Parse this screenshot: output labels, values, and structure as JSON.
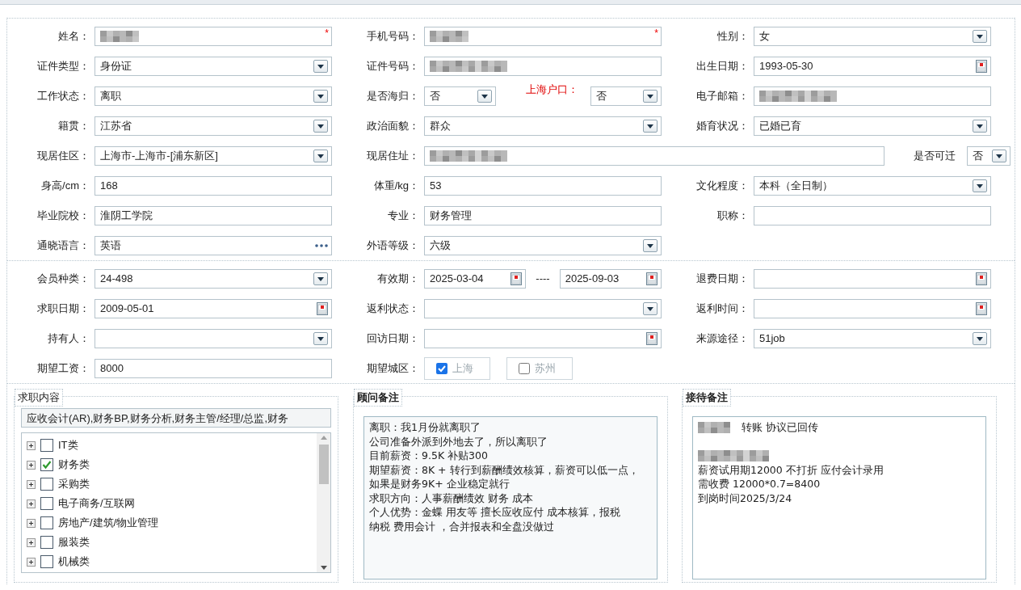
{
  "sections": [
    {
      "rows": [
        {
          "groups": [
            {
              "wide": false,
              "items": [
                {
                  "kind": "label",
                  "text": "姓名："
                },
                {
                  "kind": "text",
                  "redacted": true,
                  "required_mark": "*"
                }
              ]
            },
            {
              "wide": false,
              "items": [
                {
                  "kind": "label",
                  "text": "手机号码："
                },
                {
                  "kind": "text",
                  "redacted": true,
                  "required_mark": "*"
                }
              ]
            },
            {
              "wide": false,
              "items": [
                {
                  "kind": "label",
                  "text": "性别："
                },
                {
                  "kind": "select",
                  "value": "女"
                }
              ]
            }
          ]
        },
        {
          "groups": [
            {
              "wide": false,
              "items": [
                {
                  "kind": "label",
                  "text": "证件类型："
                },
                {
                  "kind": "select",
                  "value": "身份证"
                }
              ]
            },
            {
              "wide": false,
              "items": [
                {
                  "kind": "label",
                  "text": "证件号码："
                },
                {
                  "kind": "text",
                  "redacted": true
                }
              ]
            },
            {
              "wide": false,
              "items": [
                {
                  "kind": "label",
                  "text": "出生日期："
                },
                {
                  "kind": "date",
                  "value": "1993-05-30"
                }
              ]
            }
          ]
        },
        {
          "groups": [
            {
              "wide": false,
              "items": [
                {
                  "kind": "label",
                  "text": "工作状态："
                },
                {
                  "kind": "select",
                  "value": "离职"
                }
              ]
            },
            {
              "wide": false,
              "items": [
                {
                  "kind": "label",
                  "text": "是否海归：",
                  "alert": false
                },
                {
                  "kind": "select",
                  "value": "否"
                },
                {
                  "kind": "label",
                  "text": "上海户口：",
                  "alert": true
                },
                {
                  "kind": "select",
                  "value": "否"
                }
              ]
            },
            {
              "wide": false,
              "items": [
                {
                  "kind": "label",
                  "text": "电子邮箱："
                },
                {
                  "kind": "text",
                  "redacted": true
                }
              ]
            }
          ]
        },
        {
          "groups": [
            {
              "wide": false,
              "items": [
                {
                  "kind": "label",
                  "text": "籍贯："
                },
                {
                  "kind": "select",
                  "value": "江苏省"
                }
              ]
            },
            {
              "wide": false,
              "items": [
                {
                  "kind": "label",
                  "text": "政治面貌："
                },
                {
                  "kind": "select",
                  "value": "群众"
                }
              ]
            },
            {
              "wide": false,
              "items": [
                {
                  "kind": "label",
                  "text": "婚育状况："
                },
                {
                  "kind": "select",
                  "value": "已婚已育"
                }
              ]
            }
          ]
        },
        {
          "groups": [
            {
              "wide": false,
              "items": [
                {
                  "kind": "label",
                  "text": "现居住区："
                },
                {
                  "kind": "select",
                  "value": "上海市-上海市-[浦东新区]"
                }
              ]
            },
            {
              "wide": true,
              "items": [
                {
                  "kind": "label",
                  "text": "现居住址："
                },
                {
                  "kind": "text",
                  "redacted": true
                },
                {
                  "kind": "label",
                  "text": "是否可迁"
                },
                {
                  "kind": "select",
                  "value": "否",
                  "compact": true
                }
              ]
            }
          ]
        },
        {
          "groups": [
            {
              "wide": false,
              "items": [
                {
                  "kind": "label",
                  "text": "身高/cm："
                },
                {
                  "kind": "text",
                  "value": "168"
                }
              ]
            },
            {
              "wide": false,
              "items": [
                {
                  "kind": "label",
                  "text": "体重/kg："
                },
                {
                  "kind": "text",
                  "value": "53"
                }
              ]
            },
            {
              "wide": false,
              "items": [
                {
                  "kind": "label",
                  "text": "文化程度："
                },
                {
                  "kind": "select",
                  "value": "本科（全日制）"
                }
              ]
            }
          ]
        },
        {
          "groups": [
            {
              "wide": false,
              "items": [
                {
                  "kind": "label",
                  "text": "毕业院校："
                },
                {
                  "kind": "text",
                  "value": "淮阴工学院"
                }
              ]
            },
            {
              "wide": false,
              "items": [
                {
                  "kind": "label",
                  "text": "专业："
                },
                {
                  "kind": "text",
                  "value": "财务管理"
                }
              ]
            },
            {
              "wide": false,
              "items": [
                {
                  "kind": "label",
                  "text": "职称："
                },
                {
                  "kind": "text"
                }
              ]
            }
          ]
        },
        {
          "groups": [
            {
              "wide": false,
              "items": [
                {
                  "kind": "label",
                  "text": "通晓语言："
                },
                {
                  "kind": "lookup",
                  "value": "英语"
                }
              ]
            },
            {
              "wide": false,
              "items": [
                {
                  "kind": "label",
                  "text": "外语等级："
                },
                {
                  "kind": "select",
                  "value": "六级"
                }
              ]
            }
          ]
        }
      ]
    },
    {
      "rows": [
        {
          "groups": [
            {
              "wide": false,
              "items": [
                {
                  "kind": "label",
                  "text": "会员种类："
                },
                {
                  "kind": "select",
                  "value": "24-498"
                }
              ]
            },
            {
              "wide": false,
              "items": [
                {
                  "kind": "label",
                  "text": "有效期："
                },
                {
                  "kind": "date",
                  "value": "2025-03-04"
                },
                {
                  "kind": "separator",
                  "text": "----"
                },
                {
                  "kind": "date",
                  "value": "2025-09-03"
                }
              ]
            },
            {
              "wide": false,
              "items": [
                {
                  "kind": "label",
                  "text": "退费日期："
                },
                {
                  "kind": "date"
                }
              ]
            }
          ]
        },
        {
          "groups": [
            {
              "wide": false,
              "items": [
                {
                  "kind": "label",
                  "text": "求职日期："
                },
                {
                  "kind": "date",
                  "value": "2009-05-01"
                }
              ]
            },
            {
              "wide": false,
              "items": [
                {
                  "kind": "label",
                  "text": "返利状态："
                },
                {
                  "kind": "select"
                }
              ]
            },
            {
              "wide": false,
              "items": [
                {
                  "kind": "label",
                  "text": "返利时间："
                },
                {
                  "kind": "date"
                }
              ]
            }
          ]
        },
        {
          "groups": [
            {
              "wide": false,
              "items": [
                {
                  "kind": "label",
                  "text": "持有人："
                },
                {
                  "kind": "select"
                }
              ]
            },
            {
              "wide": false,
              "items": [
                {
                  "kind": "label",
                  "text": "回访日期："
                },
                {
                  "kind": "date"
                }
              ]
            },
            {
              "wide": false,
              "items": [
                {
                  "kind": "label",
                  "text": "来源途径："
                },
                {
                  "kind": "select",
                  "value": "51job"
                }
              ]
            }
          ]
        },
        {
          "groups": [
            {
              "wide": false,
              "items": [
                {
                  "kind": "label",
                  "text": "期望工资："
                },
                {
                  "kind": "text",
                  "value": "8000"
                }
              ]
            },
            {
              "wide": false,
              "items": [
                {
                  "kind": "label",
                  "text": "期望城区："
                },
                {
                  "kind": "checks",
                  "options": [
                    {
                      "label": "上海",
                      "checked": true
                    },
                    {
                      "label": "苏州",
                      "checked": false
                    }
                  ]
                }
              ]
            }
          ]
        }
      ]
    }
  ],
  "panels": [
    {
      "kind": "tree",
      "title": "求职内容",
      "summary": "应收会计(AR),财务BP,财务分析,财务主管/经理/总监,财务",
      "items": [
        {
          "label": "IT类",
          "checked": false,
          "expanded": false
        },
        {
          "label": "财务类",
          "checked": true,
          "expanded": false
        },
        {
          "label": "采购类",
          "checked": false,
          "expanded": false
        },
        {
          "label": "电子商务/互联网",
          "checked": false,
          "expanded": false
        },
        {
          "label": "房地产/建筑/物业管理",
          "checked": false,
          "expanded": false
        },
        {
          "label": "服装类",
          "checked": false,
          "expanded": false
        },
        {
          "label": "机械类",
          "checked": false,
          "expanded": false
        }
      ]
    },
    {
      "kind": "note",
      "title": "顾问备注",
      "lines": [
        {
          "kind": "text",
          "text": "离职：我1月份就离职了"
        },
        {
          "kind": "text",
          "text": "公司准备外派到外地去了，所以离职了"
        },
        {
          "kind": "text",
          "text": "目前薪资：9.5K 补贴300"
        },
        {
          "kind": "text",
          "text": "期望薪资：8K + 转行到薪酬绩效核算，薪资可以低一点，"
        },
        {
          "kind": "text",
          "text": "如果是财务9K+ 企业稳定就行"
        },
        {
          "kind": "text",
          "text": "求职方向：人事薪酬绩效  财务 成本"
        },
        {
          "kind": "text",
          "text": "个人优势：金蝶 用友等 擅长应收应付  成本核算，报税"
        },
        {
          "kind": "text",
          "text": "纳税 费用会计 ，合并报表和全盘没做过"
        }
      ]
    },
    {
      "kind": "note",
      "title": "接待备注",
      "lines": [
        {
          "kind": "text",
          "redacted": true,
          "text": "转账 协议已回传"
        },
        {
          "kind": "blank"
        },
        {
          "kind": "redacted"
        },
        {
          "kind": "text",
          "text": "薪资试用期12000 不打折  应付会计录用"
        },
        {
          "kind": "text",
          "text": "需收费 12000*0.7=8400"
        },
        {
          "kind": "text",
          "text": "到岗时间2025/3/24"
        }
      ]
    }
  ]
}
